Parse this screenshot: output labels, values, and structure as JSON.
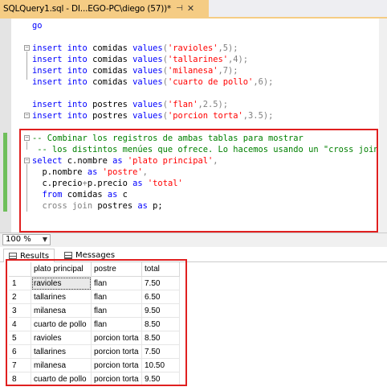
{
  "tab": {
    "title": "SQLQuery1.sql - DI...EGO-PC\\diego (57))*",
    "pin_icon": "pin-icon",
    "close_icon": "close-icon"
  },
  "editor": {
    "lines": [
      {
        "parts": [
          {
            "t": "go",
            "c": "kw"
          }
        ]
      },
      {
        "parts": []
      },
      {
        "parts": [
          {
            "t": "insert into",
            "c": "kw"
          },
          {
            "t": " comidas ",
            "c": ""
          },
          {
            "t": "values",
            "c": "kw"
          },
          {
            "t": "(",
            "c": "gr"
          },
          {
            "t": "'ravioles'",
            "c": "str"
          },
          {
            "t": ",5);",
            "c": "gr"
          }
        ]
      },
      {
        "parts": [
          {
            "t": "insert into",
            "c": "kw"
          },
          {
            "t": " comidas ",
            "c": ""
          },
          {
            "t": "values",
            "c": "kw"
          },
          {
            "t": "(",
            "c": "gr"
          },
          {
            "t": "'tallarines'",
            "c": "str"
          },
          {
            "t": ",4);",
            "c": "gr"
          }
        ]
      },
      {
        "parts": [
          {
            "t": "insert into",
            "c": "kw"
          },
          {
            "t": " comidas ",
            "c": ""
          },
          {
            "t": "values",
            "c": "kw"
          },
          {
            "t": "(",
            "c": "gr"
          },
          {
            "t": "'milanesa'",
            "c": "str"
          },
          {
            "t": ",7);",
            "c": "gr"
          }
        ]
      },
      {
        "parts": [
          {
            "t": "insert into",
            "c": "kw"
          },
          {
            "t": " comidas ",
            "c": ""
          },
          {
            "t": "values",
            "c": "kw"
          },
          {
            "t": "(",
            "c": "gr"
          },
          {
            "t": "'cuarto de pollo'",
            "c": "str"
          },
          {
            "t": ",6);",
            "c": "gr"
          }
        ]
      },
      {
        "parts": []
      },
      {
        "parts": [
          {
            "t": "insert into",
            "c": "kw"
          },
          {
            "t": " postres ",
            "c": ""
          },
          {
            "t": "values",
            "c": "kw"
          },
          {
            "t": "(",
            "c": "gr"
          },
          {
            "t": "'flan'",
            "c": "str"
          },
          {
            "t": ",2.5);",
            "c": "gr"
          }
        ]
      },
      {
        "parts": [
          {
            "t": "insert into",
            "c": "kw"
          },
          {
            "t": " postres ",
            "c": ""
          },
          {
            "t": "values",
            "c": "kw"
          },
          {
            "t": "(",
            "c": "gr"
          },
          {
            "t": "'porcion torta'",
            "c": "str"
          },
          {
            "t": ",3.5);",
            "c": "gr"
          }
        ]
      },
      {
        "parts": []
      },
      {
        "parts": [
          {
            "t": "-- Combinar los registros de ambas tablas para mostrar",
            "c": "cm"
          }
        ]
      },
      {
        "parts": [
          {
            "t": " -- los distintos menúes que ofrece. Lo hacemos usando un \"cross join\":",
            "c": "cm"
          }
        ]
      },
      {
        "parts": [
          {
            "t": "select",
            "c": "kw"
          },
          {
            "t": " c.nombre ",
            "c": ""
          },
          {
            "t": "as",
            "c": "kw"
          },
          {
            "t": " ",
            "c": ""
          },
          {
            "t": "'plato principal'",
            "c": "str"
          },
          {
            "t": ",",
            "c": "gr"
          }
        ]
      },
      {
        "parts": [
          {
            "t": "  p.nombre ",
            "c": ""
          },
          {
            "t": "as",
            "c": "kw"
          },
          {
            "t": " ",
            "c": ""
          },
          {
            "t": "'postre'",
            "c": "str"
          },
          {
            "t": ",",
            "c": "gr"
          }
        ]
      },
      {
        "parts": [
          {
            "t": "  c.precio",
            "c": ""
          },
          {
            "t": "+",
            "c": "gr"
          },
          {
            "t": "p.precio ",
            "c": ""
          },
          {
            "t": "as",
            "c": "kw"
          },
          {
            "t": " ",
            "c": ""
          },
          {
            "t": "'total'",
            "c": "str"
          }
        ]
      },
      {
        "parts": [
          {
            "t": "  ",
            "c": ""
          },
          {
            "t": "from",
            "c": "kw"
          },
          {
            "t": " comidas ",
            "c": ""
          },
          {
            "t": "as",
            "c": "kw"
          },
          {
            "t": " c",
            "c": ""
          }
        ]
      },
      {
        "parts": [
          {
            "t": "  ",
            "c": ""
          },
          {
            "t": "cross join",
            "c": "gr"
          },
          {
            "t": " postres ",
            "c": ""
          },
          {
            "t": "as",
            "c": "kw"
          },
          {
            "t": " p;",
            "c": ""
          }
        ]
      }
    ]
  },
  "zoom": {
    "value": "100 %"
  },
  "results_tabs": {
    "results": "Results",
    "messages": "Messages"
  },
  "grid": {
    "columns": [
      "plato principal",
      "postre",
      "total"
    ],
    "rows": [
      [
        "1",
        "ravioles",
        "flan",
        "7.50"
      ],
      [
        "2",
        "tallarines",
        "flan",
        "6.50"
      ],
      [
        "3",
        "milanesa",
        "flan",
        "9.50"
      ],
      [
        "4",
        "cuarto de pollo",
        "flan",
        "8.50"
      ],
      [
        "5",
        "ravioles",
        "porcion torta",
        "8.50"
      ],
      [
        "6",
        "tallarines",
        "porcion torta",
        "7.50"
      ],
      [
        "7",
        "milanesa",
        "porcion torta",
        "10.50"
      ],
      [
        "8",
        "cuarto de pollo",
        "porcion torta",
        "9.50"
      ]
    ]
  }
}
